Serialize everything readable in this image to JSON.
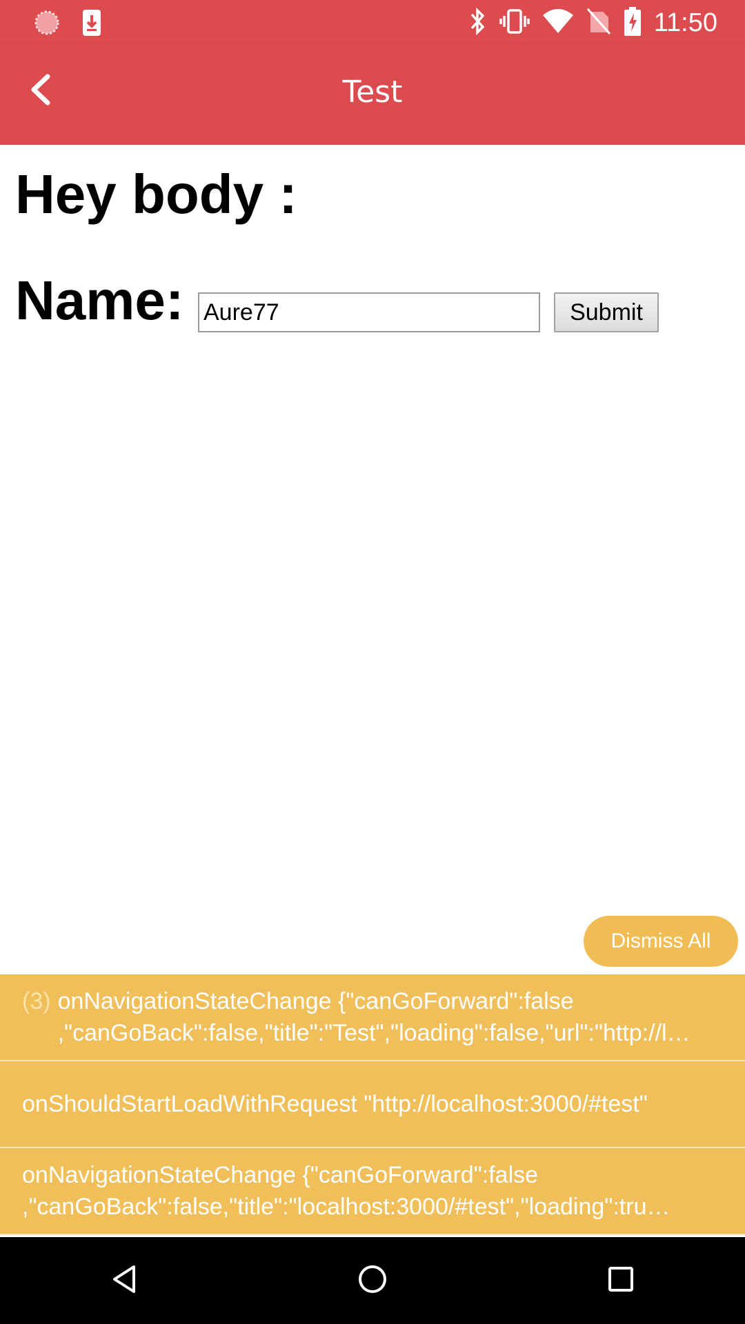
{
  "status_bar": {
    "time": "11:50",
    "left_icons": [
      "loading-icon",
      "download-icon"
    ],
    "right_icons": [
      "bluetooth-icon",
      "vibrate-icon",
      "wifi-icon",
      "no-sim-icon",
      "battery-charging-icon"
    ]
  },
  "app_bar": {
    "title": "Test",
    "back_icon": "chevron-left-icon"
  },
  "page": {
    "heading": "Hey body :",
    "name_label": "Name:",
    "name_value": "Aure77",
    "submit_label": "Submit"
  },
  "dismiss_all_label": "Dismiss All",
  "logs": [
    {
      "count": "(3)",
      "line1": "onNavigationStateChange {\"canGoForward\":false",
      "line2": ",\"canGoBack\":false,\"title\":\"Test\",\"loading\":false,\"url\":\"http://l…"
    },
    {
      "line1": "onShouldStartLoadWithRequest \"http://localhost:3000/#test\""
    },
    {
      "line1": "onNavigationStateChange {\"canGoForward\":false",
      "line2": ",\"canGoBack\":false,\"title\":\"localhost:3000/#test\",\"loading\":tru…"
    }
  ],
  "colors": {
    "primary": "#dc4c4f",
    "warning": "#f0bd55",
    "nav_bar": "#000000"
  },
  "nav_bar": [
    "back-triangle-icon",
    "home-circle-icon",
    "recents-square-icon"
  ]
}
